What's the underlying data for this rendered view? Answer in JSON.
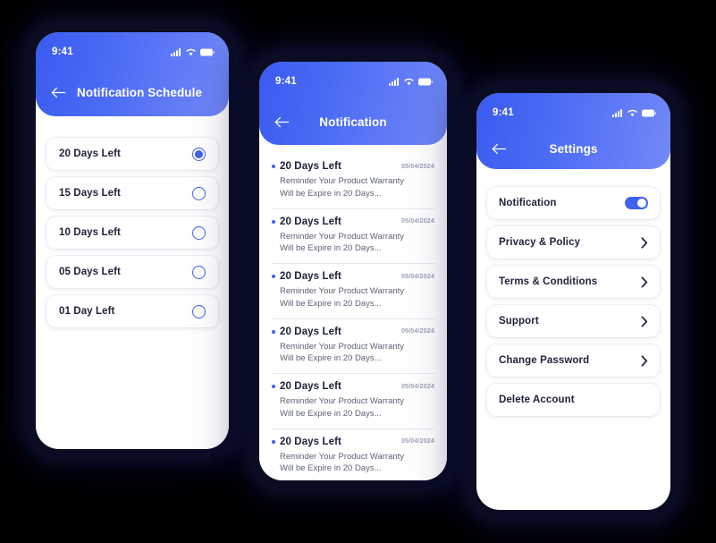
{
  "shared": {
    "status_time": "9:41",
    "icons": {
      "signal": "signal-icon",
      "wifi": "wifi-icon",
      "battery": "battery-icon",
      "back": "back-arrow-icon",
      "chevron": "chevron-right-icon"
    },
    "accent_color": "#3E62F0",
    "header_gradient_from": "#3A5BEF",
    "header_gradient_to": "#7289F7",
    "background_color": "#000000"
  },
  "screen_schedule": {
    "title": "Notification Schedule",
    "options": [
      {
        "label": "20 Days Left",
        "selected": true
      },
      {
        "label": "15 Days Left",
        "selected": false
      },
      {
        "label": "10 Days Left",
        "selected": false
      },
      {
        "label": "05 Days Left",
        "selected": false
      },
      {
        "label": "01 Day Left",
        "selected": false
      }
    ]
  },
  "screen_notification": {
    "title": "Notification",
    "items": [
      {
        "title": "20 Days Left",
        "date": "05/04/2024",
        "desc": "Reminder Your Product Warranty Will be Expire in 20 Days..."
      },
      {
        "title": "20 Days Left",
        "date": "05/04/2024",
        "desc": "Reminder Your Product Warranty Will be Expire in 20 Days..."
      },
      {
        "title": "20 Days Left",
        "date": "05/04/2024",
        "desc": "Reminder Your Product Warranty Will be Expire in 20 Days..."
      },
      {
        "title": "20 Days Left",
        "date": "05/04/2024",
        "desc": "Reminder Your Product Warranty Will be Expire in 20 Days..."
      },
      {
        "title": "20 Days Left",
        "date": "05/04/2024",
        "desc": "Reminder Your Product Warranty Will be Expire in 20 Days..."
      },
      {
        "title": "20 Days Left",
        "date": "05/04/2024",
        "desc": "Reminder Your Product Warranty Will be Expire in 20 Days..."
      }
    ]
  },
  "screen_settings": {
    "title": "Settings",
    "items": [
      {
        "label": "Notification",
        "control": "toggle",
        "toggle_on": true
      },
      {
        "label": "Privacy & Policy",
        "control": "chevron"
      },
      {
        "label": "Terms & Conditions",
        "control": "chevron"
      },
      {
        "label": "Support",
        "control": "chevron"
      },
      {
        "label": "Change Password",
        "control": "chevron"
      },
      {
        "label": "Delete Account",
        "control": "none"
      }
    ]
  }
}
